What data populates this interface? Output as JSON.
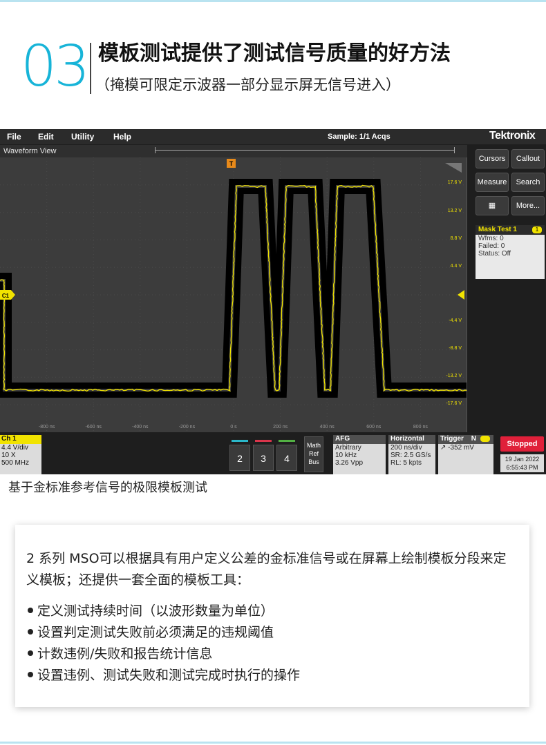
{
  "header": {
    "number": "03",
    "title": "模板测试提供了测试信号质量的好方法",
    "subtitle": "（掩模可限定示波器一部分显示屏无信号进入）"
  },
  "scope": {
    "menu": [
      "File",
      "Edit",
      "Utility",
      "Help"
    ],
    "sample_status": "Sample: 1/1 Acqs",
    "brand": "Tektronix",
    "waveform_view_title": "Waveform View",
    "trigger_marker": "T",
    "channel_marker": "C1",
    "y_labels": [
      "17.6 V",
      "13.2 V",
      "8.8 V",
      "4.4 V",
      "-4.4 V",
      "-8.8 V",
      "-13.2 V",
      "-17.6 V"
    ],
    "x_labels": [
      "-800 ns",
      "-600 ns",
      "-400 ns",
      "-200 ns",
      "0 s",
      "200 ns",
      "400 ns",
      "600 ns",
      "800 ns"
    ],
    "side_buttons": [
      "Cursors",
      "Callout",
      "Measure",
      "Search",
      "More..."
    ],
    "mask_test": {
      "title": "Mask Test 1",
      "lines": [
        "Wfms: 0",
        "Failed: 0",
        "Status: Off"
      ]
    },
    "ch1": {
      "title": "Ch 1",
      "lines": [
        "4.4 V/div",
        "10 X",
        "500 MHz"
      ]
    },
    "channel_buttons": [
      {
        "label": "2",
        "color": "#2bb7c9"
      },
      {
        "label": "3",
        "color": "#d9354b"
      },
      {
        "label": "4",
        "color": "#52b043"
      }
    ],
    "math_button": [
      "Math",
      "Ref",
      "Bus"
    ],
    "afg": {
      "title": "AFG",
      "lines": [
        "Arbitrary",
        "10 kHz",
        "3.26 Vpp"
      ]
    },
    "horizontal": {
      "title": "Horizontal",
      "lines": [
        "200 ns/div",
        "SR: 2.5 GS/s",
        "RL: 5 kpts"
      ]
    },
    "trigger": {
      "title": "Trigger",
      "mode": "N",
      "value": "-352 mV"
    },
    "run_state": "Stopped",
    "date": "19 Jan 2022",
    "time": "6:55:43 PM"
  },
  "caption": "基于金标准参考信号的极限模板测试",
  "card": {
    "paragraph": "2 系列 MSO可以根据具有用户定义公差的金标准信号或在屏幕上绘制模板分段来定义模板；还提供一套全面的模板工具：",
    "bullets": [
      "定义测试持续时间（以波形数量为单位）",
      "设置判定测试失败前必须满足的违规阈值",
      "计数违例/失败和报告统计信息",
      "设置违例、测试失败和测试完成时执行的操作"
    ]
  },
  "colors": {
    "accent": "#17b4d8",
    "trace": "#f1e300",
    "stopped": "#e0203a"
  }
}
